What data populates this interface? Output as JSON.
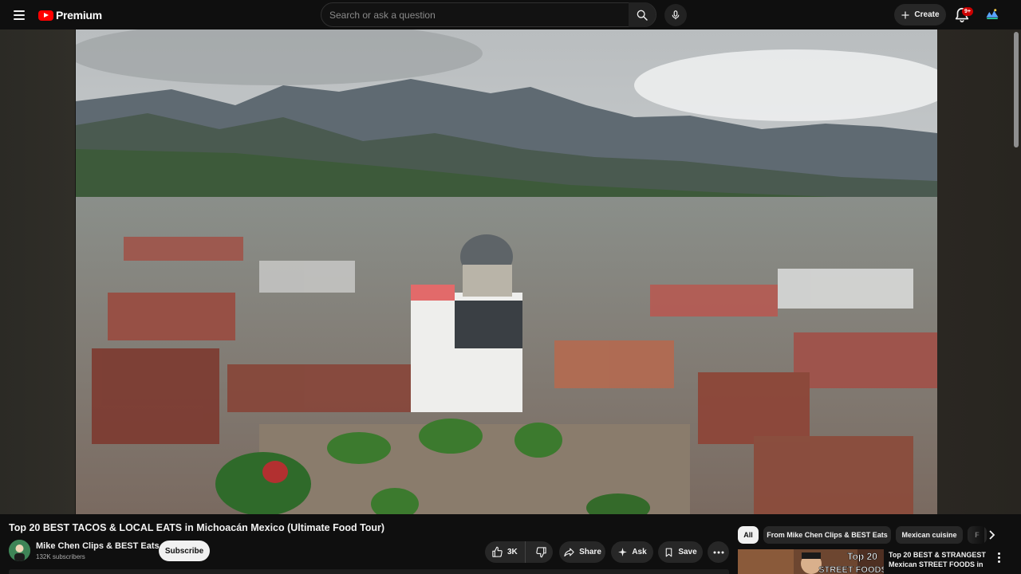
{
  "app": {
    "logo_text": "Premium",
    "search": {
      "placeholder": "Search or ask a question"
    },
    "create_label": "Create",
    "notification_badge": "9+",
    "colors": {
      "brand_red": "#ff0000",
      "badge_red": "#cc0000",
      "background": "#0f0f0f",
      "pill": "#272727"
    },
    "icons": [
      "menu-icon",
      "youtube-logo",
      "search-icon",
      "microphone-icon",
      "plus-icon",
      "bell-icon",
      "account-avatar"
    ]
  },
  "video": {
    "title": "Top 20 BEST TACOS & LOCAL EATS in Michoacán Mexico (Ultimate Food Tour)"
  },
  "channel": {
    "name": "Mike Chen Clips & BEST Eats",
    "subscribers": "132K subscribers",
    "subscribe_label": "Subscribe"
  },
  "actions": {
    "like_count": "3K",
    "share_label": "Share",
    "ask_label": "Ask",
    "save_label": "Save"
  },
  "chips": [
    {
      "label": "All",
      "active": true
    },
    {
      "label": "From Mike Chen Clips & BEST Eats",
      "active": false
    },
    {
      "label": "Mexican cuisine",
      "active": false
    },
    {
      "label": "F",
      "active": false
    }
  ],
  "related": [
    {
      "thumbnail_text_1": "Top 20",
      "thumbnail_text_2": "STREET FOODS",
      "title": "Top 20 BEST & STRANGEST Mexican STREET FOODS in ..."
    }
  ]
}
